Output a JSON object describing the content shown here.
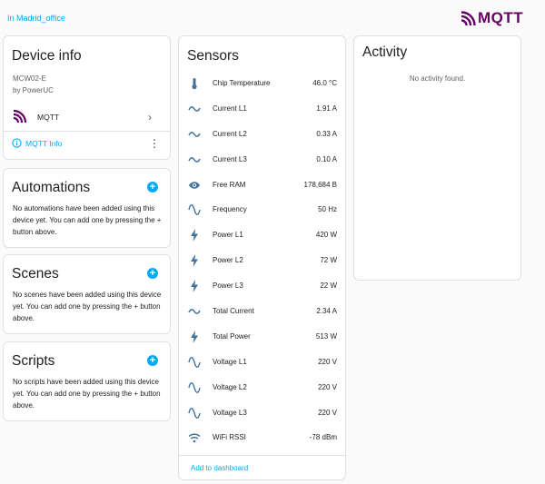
{
  "header": {
    "area_link": "In Madrid_office",
    "logo_text": "MQTT",
    "logo_color": "#660066"
  },
  "device_info": {
    "title": "Device info",
    "model": "MCW02-E",
    "manufacturer": "by PowerUC",
    "integration_label": "MQTT",
    "info_link": "MQTT Info"
  },
  "automations": {
    "title": "Automations",
    "text": "No automations have been added using this device yet. You can add one by pressing the + button above."
  },
  "scenes": {
    "title": "Scenes",
    "text": "No scenes have been added using this device yet. You can add one by pressing the + button above."
  },
  "scripts": {
    "title": "Scripts",
    "text": "No scripts have been added using this device yet. You can add one by pressing the + button above."
  },
  "sensors": {
    "title": "Sensors",
    "items": [
      {
        "icon": "thermometer-icon",
        "name": "Chip Temperature",
        "value": "46.0 °C"
      },
      {
        "icon": "current-ac-icon",
        "name": "Current L1",
        "value": "1.91 A"
      },
      {
        "icon": "current-ac-icon",
        "name": "Current L2",
        "value": "0.33 A"
      },
      {
        "icon": "current-ac-icon",
        "name": "Current L3",
        "value": "0.10 A"
      },
      {
        "icon": "eye-icon",
        "name": "Free RAM",
        "value": "178,684 B"
      },
      {
        "icon": "sine-wave-icon",
        "name": "Frequency",
        "value": "50 Hz"
      },
      {
        "icon": "flash-icon",
        "name": "Power L1",
        "value": "420 W"
      },
      {
        "icon": "flash-icon",
        "name": "Power L2",
        "value": "72 W"
      },
      {
        "icon": "flash-icon",
        "name": "Power L3",
        "value": "22 W"
      },
      {
        "icon": "current-ac-icon",
        "name": "Total Current",
        "value": "2.34 A"
      },
      {
        "icon": "flash-icon",
        "name": "Total Power",
        "value": "513 W"
      },
      {
        "icon": "sine-wave-icon",
        "name": "Voltage L1",
        "value": "220 V"
      },
      {
        "icon": "sine-wave-icon",
        "name": "Voltage L2",
        "value": "220 V"
      },
      {
        "icon": "sine-wave-icon",
        "name": "Voltage L3",
        "value": "220 V"
      },
      {
        "icon": "wifi-icon",
        "name": "WiFi RSSI",
        "value": "-78 dBm"
      }
    ],
    "add_to_dashboard": "Add to dashboard"
  },
  "activity": {
    "title": "Activity",
    "empty_text": "No activity found."
  },
  "colors": {
    "accent": "#03a9f4",
    "icon": "#44739e",
    "mqtt_brand": "#660066"
  }
}
